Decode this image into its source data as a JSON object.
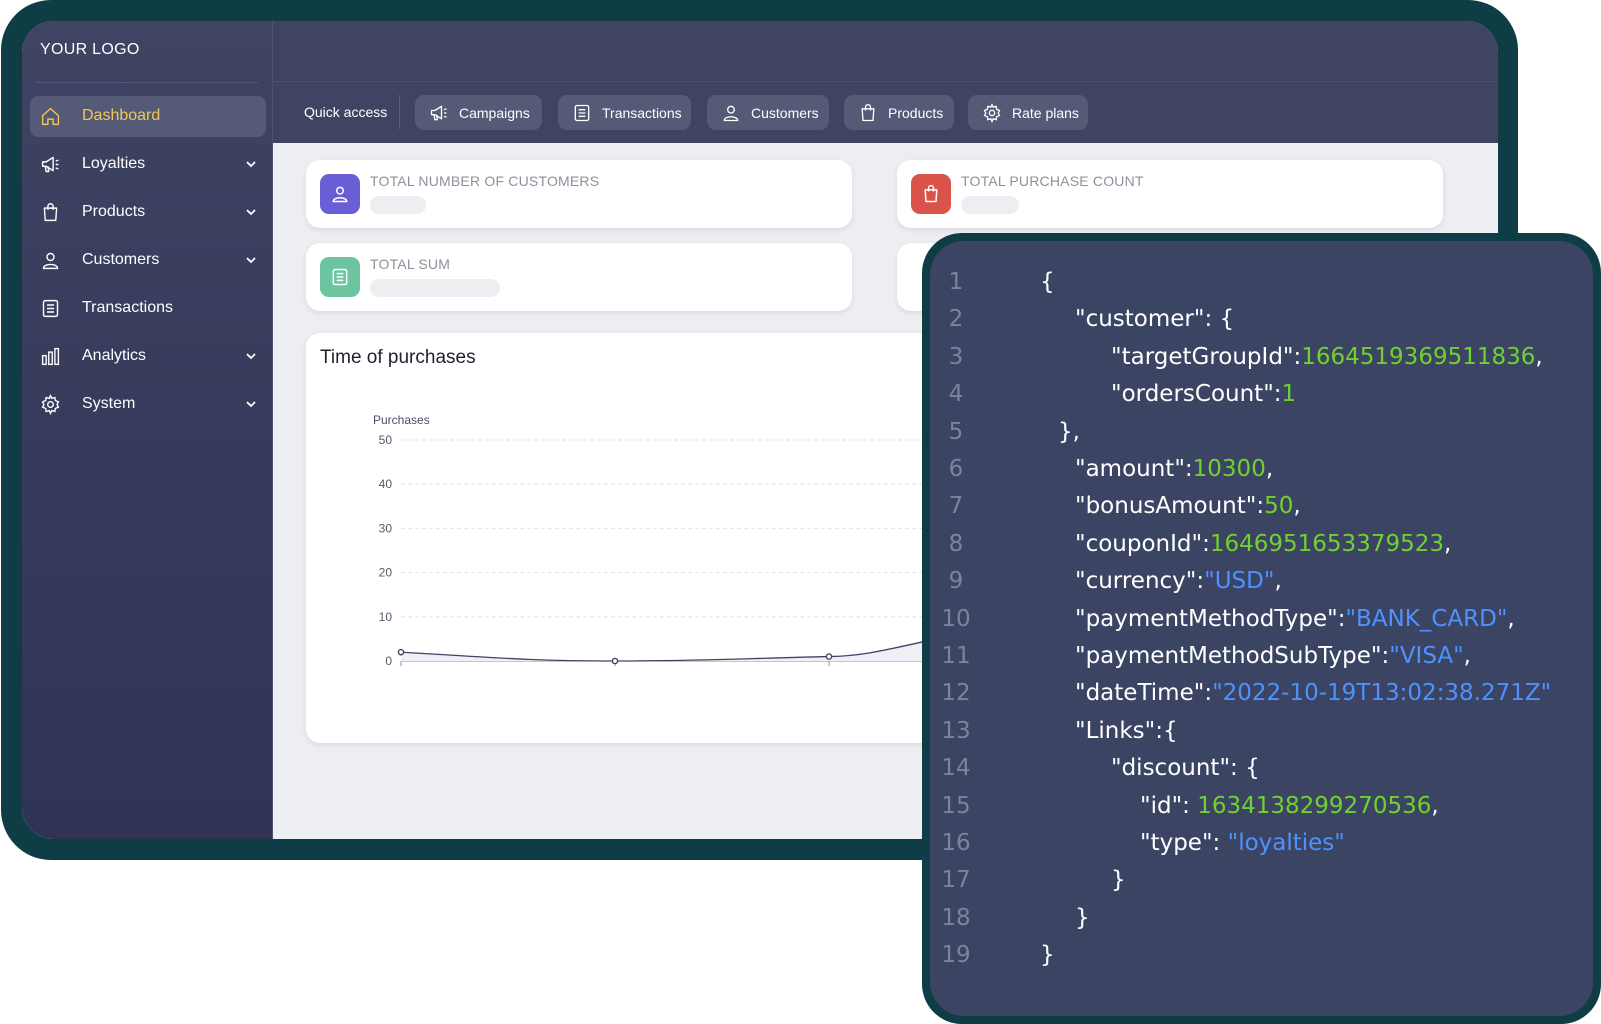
{
  "app": {
    "logo": "YOUR LOGO",
    "accent_color": "#f1c659",
    "sidebar_bg": "#3f4463"
  },
  "sidebar": {
    "items": [
      {
        "label": "Dashboard",
        "icon": "home-icon",
        "active": true,
        "expandable": false
      },
      {
        "label": "Loyalties",
        "icon": "megaphone-icon",
        "active": false,
        "expandable": true
      },
      {
        "label": "Products",
        "icon": "shopping-bag-icon",
        "active": false,
        "expandable": true
      },
      {
        "label": "Customers",
        "icon": "user-icon",
        "active": false,
        "expandable": true
      },
      {
        "label": "Transactions",
        "icon": "receipt-icon",
        "active": false,
        "expandable": false
      },
      {
        "label": "Analytics",
        "icon": "bar-chart-icon",
        "active": false,
        "expandable": true
      },
      {
        "label": "System",
        "icon": "gear-icon",
        "active": false,
        "expandable": true
      }
    ]
  },
  "quick_access": {
    "label": "Quick access",
    "buttons": [
      {
        "label": "Campaigns",
        "icon": "megaphone-icon"
      },
      {
        "label": "Transactions",
        "icon": "receipt-icon"
      },
      {
        "label": "Customers",
        "icon": "user-icon"
      },
      {
        "label": "Products",
        "icon": "shopping-bag-icon"
      },
      {
        "label": "Rate plans",
        "icon": "gear-icon"
      }
    ]
  },
  "stats": [
    {
      "title": "TOTAL NUMBER OF CUSTOMERS",
      "icon": "user-icon",
      "color": "#6a5ed4",
      "loading": true
    },
    {
      "title": "TOTAL PURCHASE COUNT",
      "icon": "shopping-bag-icon",
      "color": "#d9534a",
      "loading": true
    },
    {
      "title": "TOTAL SUM",
      "icon": "receipt-icon",
      "color": "#6cc4a1",
      "loading": true
    }
  ],
  "chart_panel": {
    "title": "Time of purchases"
  },
  "chart_data": {
    "type": "area",
    "title": "Time of purchases",
    "ylabel": "Purchases",
    "xlabel": "",
    "ylim": [
      0,
      50
    ],
    "yticks": [
      0,
      10,
      20,
      30,
      40,
      50
    ],
    "grid": true,
    "series": [
      {
        "values": [
          2,
          0,
          1,
          10
        ]
      }
    ],
    "line_color": "#3f4463"
  },
  "code": {
    "lines": [
      [
        {
          "t": "{",
          "c": "pun"
        }
      ],
      [
        {
          "t": "\"customer\"",
          "c": "key"
        },
        {
          "t": ": {",
          "c": "pun"
        }
      ],
      [
        {
          "t": "\"targetGroupId\"",
          "c": "key"
        },
        {
          "t": ":",
          "c": "pun"
        },
        {
          "t": "1664519369511836",
          "c": "num"
        },
        {
          "t": ",",
          "c": "pun"
        }
      ],
      [
        {
          "t": "\"ordersCount\"",
          "c": "key"
        },
        {
          "t": ":",
          "c": "pun"
        },
        {
          "t": "1",
          "c": "num"
        }
      ],
      [
        {
          "t": "},",
          "c": "pun"
        }
      ],
      [
        {
          "t": "\"amount\"",
          "c": "key"
        },
        {
          "t": ":",
          "c": "pun"
        },
        {
          "t": "10300",
          "c": "num"
        },
        {
          "t": ",",
          "c": "pun"
        }
      ],
      [
        {
          "t": "\"bonusAmount\"",
          "c": "key"
        },
        {
          "t": ":",
          "c": "pun"
        },
        {
          "t": "50",
          "c": "num"
        },
        {
          "t": ",",
          "c": "pun"
        }
      ],
      [
        {
          "t": "\"couponId\"",
          "c": "key"
        },
        {
          "t": ":",
          "c": "pun"
        },
        {
          "t": "1646951653379523",
          "c": "num"
        },
        {
          "t": ",",
          "c": "pun"
        }
      ],
      [
        {
          "t": "\"currency\"",
          "c": "key"
        },
        {
          "t": ":",
          "c": "pun"
        },
        {
          "t": "\"USD\"",
          "c": "str"
        },
        {
          "t": ",",
          "c": "pun"
        }
      ],
      [
        {
          "t": "\"paymentMethodType\"",
          "c": "key"
        },
        {
          "t": ":",
          "c": "pun"
        },
        {
          "t": "\"BANK_CARD\"",
          "c": "str"
        },
        {
          "t": ",",
          "c": "pun"
        }
      ],
      [
        {
          "t": "\"paymentMethodSubType\"",
          "c": "key"
        },
        {
          "t": ":",
          "c": "pun"
        },
        {
          "t": "\"VISA\"",
          "c": "str"
        },
        {
          "t": ",",
          "c": "pun"
        }
      ],
      [
        {
          "t": "\"dateTime\"",
          "c": "key"
        },
        {
          "t": ":",
          "c": "pun"
        },
        {
          "t": "\"2022-10-19T13:02:38.271Z\"",
          "c": "str"
        }
      ],
      [
        {
          "t": "\"Links\"",
          "c": "key"
        },
        {
          "t": ":{",
          "c": "pun"
        }
      ],
      [
        {
          "t": "\"discount\"",
          "c": "key"
        },
        {
          "t": ": {",
          "c": "pun"
        }
      ],
      [
        {
          "t": "\"id\"",
          "c": "key"
        },
        {
          "t": ": ",
          "c": "pun"
        },
        {
          "t": "1634138299270536",
          "c": "num"
        },
        {
          "t": ",",
          "c": "pun"
        }
      ],
      [
        {
          "t": "\"type\"",
          "c": "key"
        },
        {
          "t": ": ",
          "c": "pun"
        },
        {
          "t": "\"loyalties\"",
          "c": "str"
        }
      ],
      [
        {
          "t": "}",
          "c": "pun"
        }
      ],
      [
        {
          "t": "}",
          "c": "pun"
        }
      ],
      [
        {
          "t": "}",
          "c": "pun"
        }
      ]
    ],
    "line_numbers": [
      "1",
      "2",
      "3",
      "4",
      "5",
      "6",
      "7",
      "8",
      "9",
      "10",
      "11",
      "12",
      "13",
      "14",
      "15",
      "16",
      "17",
      "18",
      "19"
    ],
    "colors": {
      "key": "#ffffff",
      "num": "#6fd22f",
      "str": "#4d92ff",
      "line_number": "#7d839f"
    }
  }
}
